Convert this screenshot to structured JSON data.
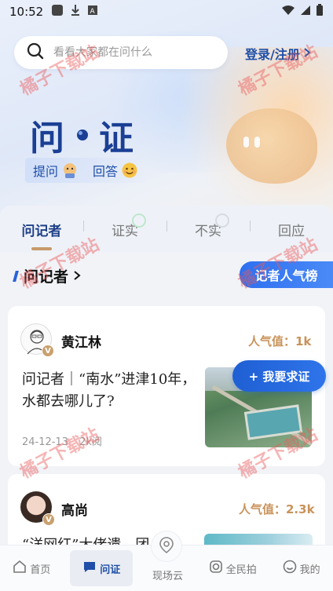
{
  "status_bar": {
    "time": "10:52"
  },
  "search": {
    "placeholder": "看看大家都在问什么"
  },
  "login": {
    "label": "登录/注册"
  },
  "hero": {
    "title_left": "问",
    "title_right": "证",
    "ask_label": "提问",
    "answer_label": "回答"
  },
  "tabs": [
    {
      "label": "问记者",
      "active": true
    },
    {
      "label": "证实",
      "active": false
    },
    {
      "label": "不实",
      "active": false
    },
    {
      "label": "回应",
      "active": false
    }
  ],
  "section": {
    "title": "问记者",
    "ranking_label": "记者人气榜"
  },
  "cards": [
    {
      "reporter": "黄江林",
      "popularity": "人气值：1k",
      "title": "问记者｜“南水”进津10年，水都去哪儿了?",
      "date": "24-12-13",
      "extra": "2k阅",
      "badge": "V"
    },
    {
      "reporter": "高尚",
      "popularity": "人气值：2.3k",
      "title": "“洋网红”大佬遗…团",
      "badge": "V"
    }
  ],
  "cta": {
    "label": "+ 我要求证"
  },
  "watermark": "橘子下载站",
  "bottom_nav": [
    {
      "label": "首页",
      "icon": "home-icon"
    },
    {
      "label": "问证",
      "icon": "chat-icon",
      "active": true
    },
    {
      "label": "现场云",
      "icon": "location-icon"
    },
    {
      "label": "全民拍",
      "icon": "camera-icon"
    },
    {
      "label": "我的",
      "icon": "profile-icon"
    }
  ]
}
